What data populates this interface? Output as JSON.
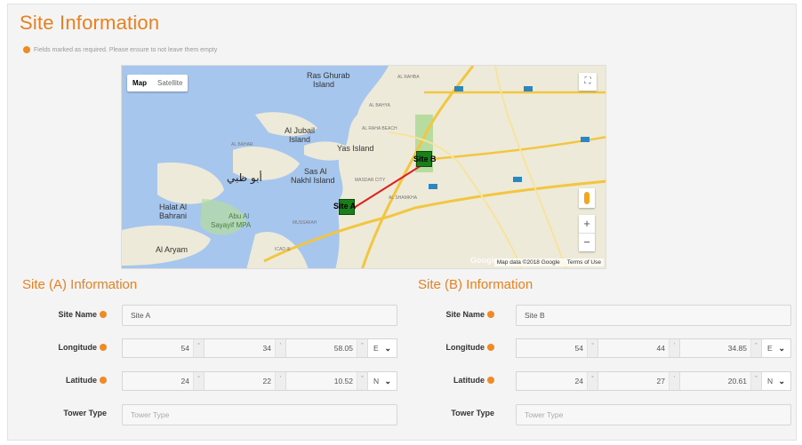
{
  "page": {
    "title": "Site Information",
    "required_note": "Fields marked as required. Please ensure to not leave them empty"
  },
  "map": {
    "type_map": "Map",
    "type_satellite": "Satellite",
    "attribution_data": "Map data ©2018 Google",
    "attribution_terms": "Terms of Use",
    "google_logo": "Google",
    "fullscreen_icon": "fullscreen-icon",
    "zoom_in": "+",
    "zoom_out": "−",
    "labels": {
      "ras_ghurab": "Ras Ghurab",
      "island": "Island",
      "al_jubail": "Al Jubail",
      "island2": "Island",
      "yas_island": "Yas Island",
      "abu_dhabi_ar": "أبو ظبي",
      "sas_al_nakhl": "Sas Al",
      "nakhl_island": "Nakhl Island",
      "halat_al": "Halat Al",
      "bahrani": "Bahrani",
      "abu_al": "Abu Al",
      "sayayif": "Sayayif MPA",
      "al_aryam": "Al Aryam",
      "al_rahba": "AL RAHBA",
      "al_bahya": "AL BAHYA",
      "al_raha_beach": "AL RAHA BEACH",
      "al_bahar": "AL BAHAR",
      "masdar_city": "MASDAR CITY",
      "al_khawaneej": "AL SHAMKHA",
      "mussafah": "MUSSAFAH",
      "icad": "ICAD III"
    },
    "site_a_label": "Site A",
    "site_b_label": "Site B",
    "colors": {
      "water": "#a6c6ee",
      "land": "#eeead9",
      "park": "#b7dca0",
      "link": "#e02020",
      "marker": "#1a7f1a"
    }
  },
  "site_a": {
    "title": "Site (A) Information",
    "name_label": "Site Name",
    "name_value": "Site A",
    "lon_label": "Longitude",
    "lon_deg": "54",
    "lon_min": "34",
    "lon_sec": "58.05",
    "lon_dir": "E",
    "lat_label": "Latitude",
    "lat_deg": "24",
    "lat_min": "22",
    "lat_sec": "10.52",
    "lat_dir": "N",
    "tower_label": "Tower Type",
    "tower_placeholder": "Tower Type"
  },
  "site_b": {
    "title": "Site (B) Information",
    "name_label": "Site Name",
    "name_value": "Site B",
    "lon_label": "Longitude",
    "lon_deg": "54",
    "lon_min": "44",
    "lon_sec": "34.85",
    "lon_dir": "E",
    "lat_label": "Latitude",
    "lat_deg": "24",
    "lat_min": "27",
    "lat_sec": "20.61",
    "lat_dir": "N",
    "tower_label": "Tower Type",
    "tower_placeholder": "Tower Type"
  },
  "units": {
    "deg": "°",
    "min": "'",
    "sec": "\""
  }
}
